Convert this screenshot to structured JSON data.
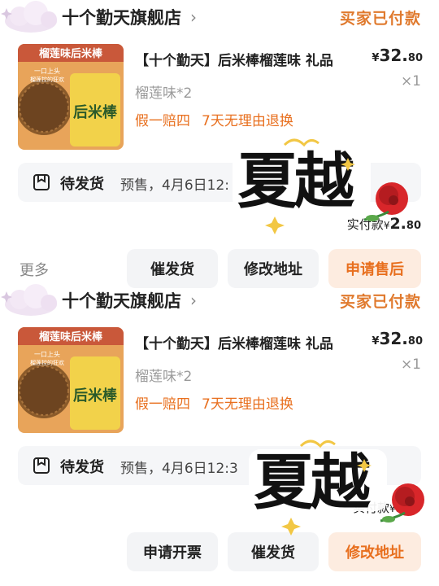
{
  "orders": [
    {
      "shop_name": "十个勤天旗舰店",
      "pay_status": "买家已付款",
      "product": {
        "thumb_text_top": "榴莲味后米棒",
        "thumb_text_sub": "一口上头",
        "thumb_text_sub2": "榴莲控的狂欢",
        "thumb_brand": "后米棒",
        "title": "【十个勤天】后米棒榴莲味 礼品",
        "price_symbol": "¥",
        "price_int": "32.",
        "price_dec": "80",
        "quantity": "×1",
        "sku": "榴莲味*2",
        "tags": [
          "假一赔四",
          "7天无理由退换"
        ]
      },
      "shipping": {
        "status": "待发货",
        "detail": "预售，4月6日12:"
      },
      "paid": {
        "label": "实付款",
        "symbol": "¥",
        "int": "2.",
        "dec": "80"
      },
      "more_label": "更多",
      "buttons": [
        "催发货",
        "修改地址",
        "申请售后"
      ]
    },
    {
      "shop_name": "十个勤天旗舰店",
      "pay_status": "买家已付款",
      "product": {
        "thumb_text_top": "榴莲味后米棒",
        "thumb_text_sub": "一口上头",
        "thumb_text_sub2": "榴莲控的狂欢",
        "thumb_brand": "后米棒",
        "title": "【十个勤天】后米棒榴莲味 礼品",
        "price_symbol": "¥",
        "price_int": "32.",
        "price_dec": "80",
        "quantity": "×1",
        "sku": "榴莲味*2",
        "tags": [
          "假一赔四",
          "7天无理由退换"
        ]
      },
      "shipping": {
        "status": "待发货",
        "detail": "预售，4月6日12:3"
      },
      "paid": {
        "label": "实付款",
        "symbol": "¥",
        "int": "3",
        "dec": "80"
      },
      "buttons": [
        "申请开票",
        "催发货",
        "修改地址"
      ]
    }
  ],
  "stickers": [
    {
      "text": "夏越"
    },
    {
      "text": "夏越"
    }
  ],
  "colors": {
    "accent": "#e86f1e",
    "status": "#e07a2e",
    "button_bg": "#f3f4f6",
    "primary_button_bg": "#fdece0",
    "ship_box_bg": "#f5f6f8"
  },
  "icons": {
    "shop_chevron": "chevron-right-icon",
    "shipping": "package-box-icon",
    "decor": "cloud-icon"
  }
}
